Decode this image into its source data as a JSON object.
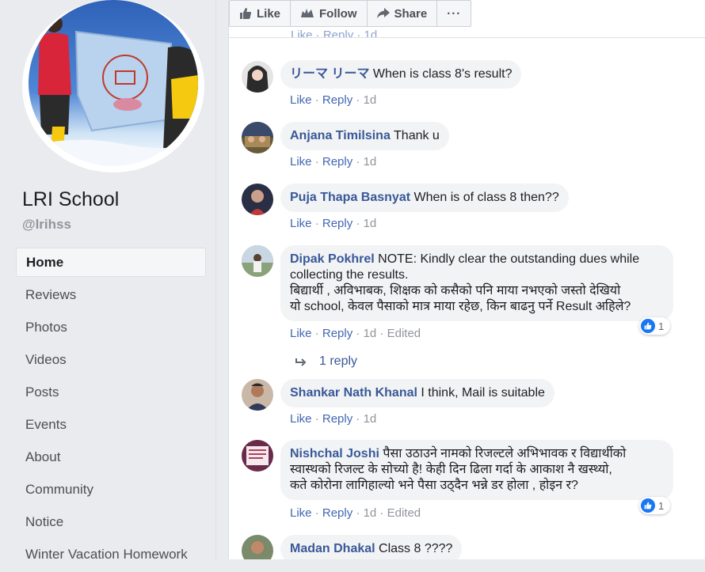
{
  "page": {
    "name": "LRI School",
    "handle": "@lrihss",
    "nav": [
      "Home",
      "Reviews",
      "Photos",
      "Videos",
      "Posts",
      "Events",
      "About",
      "Community",
      "Notice",
      "Winter Vacation Homework"
    ]
  },
  "actions": {
    "like": "Like",
    "follow": "Follow",
    "share": "Share",
    "more": "···"
  },
  "labels": {
    "like": "Like",
    "reply": "Reply",
    "sep": " · ",
    "edited": "Edited",
    "partial_meta": "Like · Reply · 1d"
  },
  "comments": [
    {
      "author": "リーマ リーマ",
      "text": "When is class 8's result?",
      "time": "1d"
    },
    {
      "author": "Anjana Timilsina",
      "text": "Thank u",
      "time": "1d"
    },
    {
      "author": "Puja Thapa Basnyat",
      "text": "When is of class 8 then??",
      "time": "1d"
    },
    {
      "author": "Dipak Pokhrel",
      "line1": "NOTE: Kindly clear the outstanding dues while",
      "line2": "collecting the results.",
      "line3": "बिद्यार्थी , अविभाबक, शिक्षक को कसैको पनि माया नभएको जस्तो देखियो",
      "line4": "यो school, केवल पैसाको मात्र माया रहेछ, किन बाढनु पर्ने Result अहिले?",
      "time": "1d",
      "reactions": "1"
    },
    {
      "author": "Shankar Nath Khanal",
      "text": "I think, Mail is suitable",
      "time": "1d"
    },
    {
      "author": "Nishchal Joshi",
      "line1": "पैसा उठाउने नामको रिजल्टले अभिभावक र विद्यार्थीको",
      "line2": "स्वास्थको रिजल्ट के सोच्यो है! केही दिन ढिला गर्दा के आकाश नै खस्थ्यो,",
      "line3": "कते कोरोना लागिहाल्यो भने पैसा उठ्दैन भन्ने डर होला , होइन र?",
      "time": "1d",
      "reactions": "1"
    },
    {
      "author": "Madan Dhakal",
      "text": "Class 8 ????"
    }
  ],
  "reply_count": "1 reply",
  "colors": {
    "link": "#385898",
    "meta": "#4267b2",
    "bubble": "#f2f3f5",
    "like_blue": "#1877f2"
  }
}
